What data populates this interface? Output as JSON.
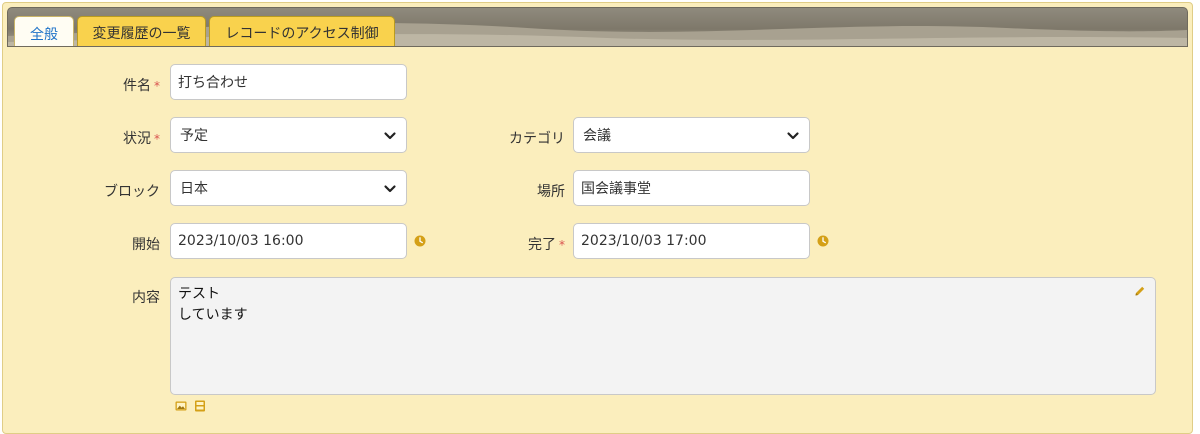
{
  "tabs": [
    {
      "label": "全般",
      "active": true
    },
    {
      "label": "変更履歴の一覧",
      "active": false
    },
    {
      "label": "レコードのアクセス制御",
      "active": false
    }
  ],
  "fields": {
    "subject": {
      "label": "件名",
      "required": true,
      "value": "打ち合わせ"
    },
    "status": {
      "label": "状況",
      "required": true,
      "value": "予定"
    },
    "category": {
      "label": "カテゴリ",
      "required": false,
      "value": "会議"
    },
    "block": {
      "label": "ブロック",
      "required": false,
      "value": "日本"
    },
    "location": {
      "label": "場所",
      "required": false,
      "value": "国会議事堂"
    },
    "start": {
      "label": "開始",
      "required": false,
      "value": "2023/10/03 16:00"
    },
    "end": {
      "label": "完了",
      "required": true,
      "value": "2023/10/03 17:00"
    },
    "content": {
      "label": "内容",
      "required": false,
      "lines": [
        "テスト",
        "しています"
      ]
    }
  },
  "required_mark": "*",
  "colors": {
    "panel_background": "#fbeebd",
    "tab_inactive": "#f9d24d",
    "tab_active_text": "#1f73c8",
    "tabbar": "#7e786a",
    "icon": "#d4a017",
    "required": "#d9534f"
  },
  "icons": {
    "select_arrow": "chevron-down-icon",
    "time_picker": "clock-icon",
    "edit": "pencil-icon",
    "insert_image": "image-icon",
    "attach_file": "file-icon"
  }
}
